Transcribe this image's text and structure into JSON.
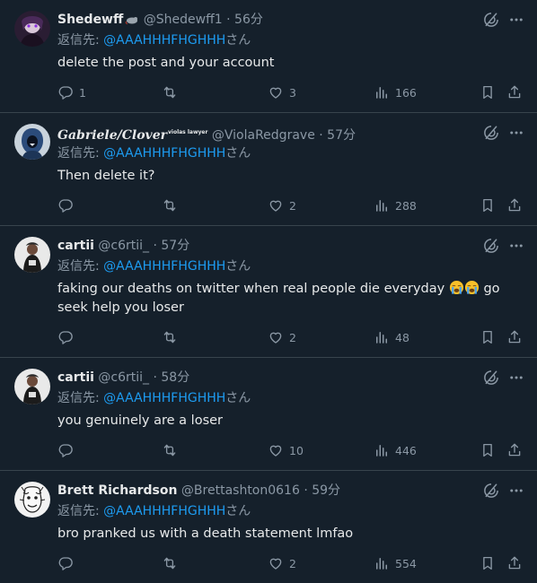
{
  "reply_prefix": "返信先: ",
  "reply_suffix": "さん",
  "colors": {
    "background": "#15202b",
    "text": "#e7e9ea",
    "muted": "#8b98a5",
    "link": "#1d9bf0",
    "divider": "#38444d"
  },
  "icons": [
    "grok-icon",
    "more-icon",
    "reply-icon",
    "retweet-icon",
    "like-icon",
    "views-icon",
    "bookmark-icon",
    "share-icon"
  ],
  "tweets": [
    {
      "name": "Shedewff",
      "handle": "@Shedewff1",
      "time": "· 56分",
      "reply_to": "@AAAHHHFHGHHH",
      "text": "delete the post and your account",
      "replies": "1",
      "retweets": "",
      "likes": "3",
      "views": "166"
    },
    {
      "name": "Gabriele/Clover",
      "badge": "violas lawyer",
      "handle": "@ViolaRedgrave",
      "time": "· 57分",
      "reply_to": "@AAAHHHFHGHHH",
      "text": "Then delete it?",
      "replies": "",
      "retweets": "",
      "likes": "2",
      "views": "288"
    },
    {
      "name": "cartii",
      "handle": "@c6rtii_",
      "time": "· 57分",
      "reply_to": "@AAAHHHFHGHHH",
      "text": "faking our deaths on twitter when real people die everyday",
      "text_after_emoji": " go seek help you loser",
      "replies": "",
      "retweets": "",
      "likes": "2",
      "views": "48"
    },
    {
      "name": "cartii",
      "handle": "@c6rtii_",
      "time": "· 58分",
      "reply_to": "@AAAHHHFHGHHH",
      "text": "you genuinely are a loser",
      "replies": "",
      "retweets": "",
      "likes": "10",
      "views": "446"
    },
    {
      "name": "Brett Richardson",
      "handle": "@Brettashton0616",
      "time": "· 59分",
      "reply_to": "@AAAHHHFHGHHH",
      "text": "bro pranked us with a death statement lmfao",
      "replies": "",
      "retweets": "",
      "likes": "2",
      "views": "554"
    }
  ]
}
